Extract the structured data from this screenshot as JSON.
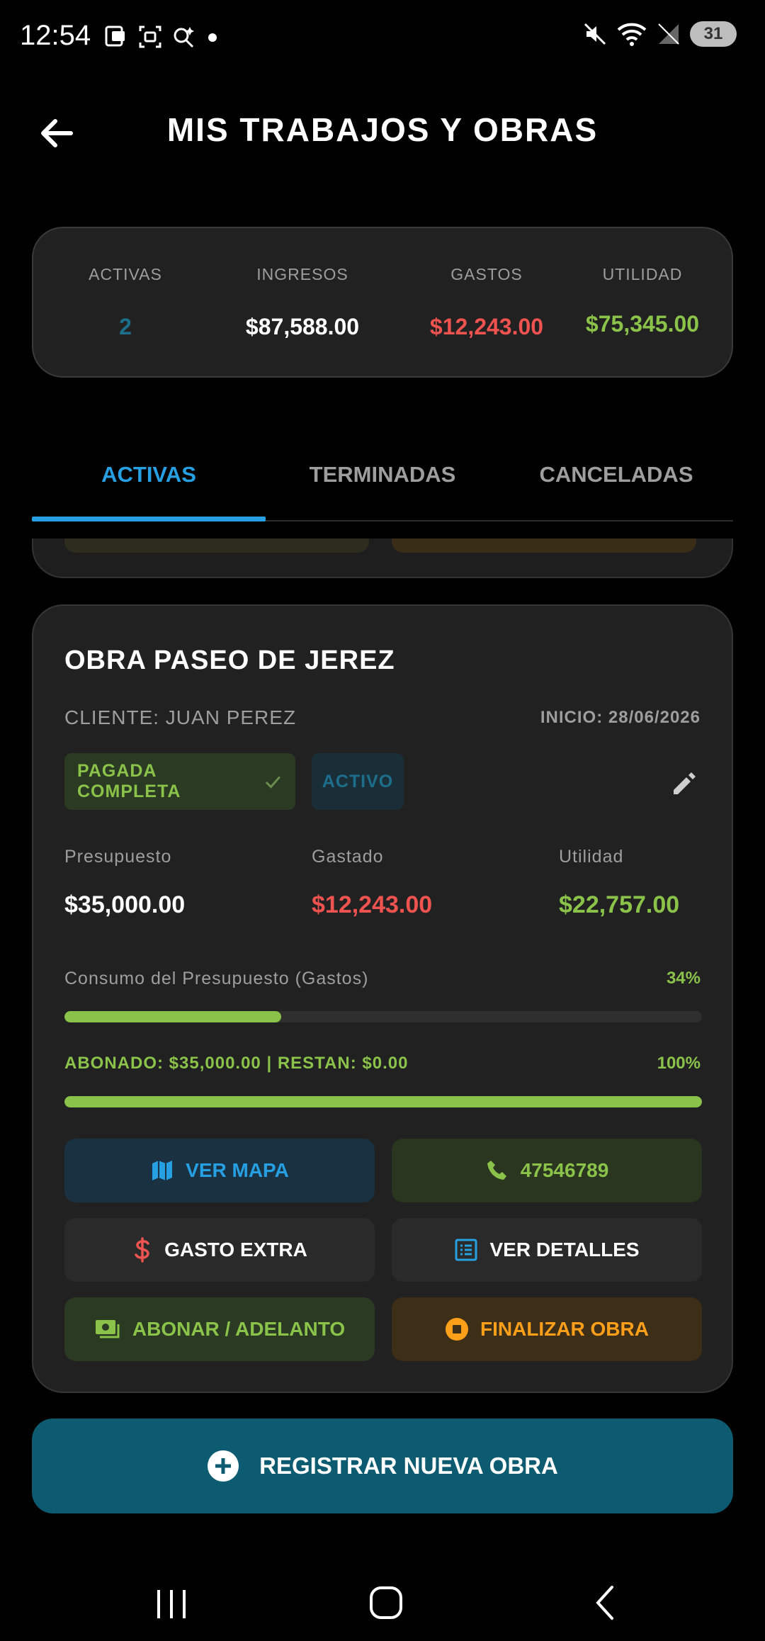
{
  "status_bar": {
    "time": "12:54",
    "battery": "31",
    "icons": [
      "sim-icon",
      "screenshot-icon",
      "assistant-icon",
      "notification-dot-icon",
      "mute-icon",
      "wifi-icon",
      "signal-icon",
      "battery-icon"
    ]
  },
  "header": {
    "title": "MIS TRABAJOS Y OBRAS",
    "back_icon": "arrow-left-icon"
  },
  "summary": {
    "activas": {
      "label": "ACTIVAS",
      "value": "2"
    },
    "ingresos": {
      "label": "INGRESOS",
      "value": "$87,588.00"
    },
    "gastos": {
      "label": "GASTOS",
      "value": "$12,243.00"
    },
    "utilidad": {
      "label": "UTILIDAD",
      "value": "$75,345.00"
    }
  },
  "tabs": [
    {
      "label": "ACTIVAS",
      "active": true
    },
    {
      "label": "TERMINADAS",
      "active": false
    },
    {
      "label": "CANCELADAS",
      "active": false
    }
  ],
  "card": {
    "title": "OBRA PASEO DE JEREZ",
    "client": "CLIENTE: JUAN PEREZ",
    "start": "INICIO: 28/06/2026",
    "badge_paid": "PAGADA COMPLETA",
    "badge_paid_icon": "check-icon",
    "badge_status": "ACTIVO",
    "edit_icon": "pencil-icon",
    "presupuesto": {
      "label": "Presupuesto",
      "value": "$35,000.00"
    },
    "gastado": {
      "label": "Gastado",
      "value": "$12,243.00"
    },
    "utilidad": {
      "label": "Utilidad",
      "value": "$22,757.00"
    },
    "consumo": {
      "label": "Consumo del Presupuesto (Gastos)",
      "percent_text": "34%",
      "fraction": 0.34
    },
    "abonado": {
      "label": "ABONADO: $35,000.00 | RESTAN: $0.00",
      "percent_text": "100%",
      "fraction": 1.0
    },
    "buttons": {
      "map": {
        "label": "VER MAPA",
        "icon": "map-icon"
      },
      "phone": {
        "label": "47546789",
        "icon": "phone-icon"
      },
      "extra": {
        "label": "GASTO EXTRA",
        "icon": "dollar-icon"
      },
      "details": {
        "label": "VER DETALLES",
        "icon": "list-icon"
      },
      "pay": {
        "label": "ABONAR / ADELANTO",
        "icon": "cash-icon"
      },
      "finish": {
        "label": "FINALIZAR OBRA",
        "icon": "stop-circle-icon"
      }
    }
  },
  "register_button": {
    "label": "REGISTRAR NUEVA OBRA",
    "icon": "plus-circle-icon"
  },
  "nav_bar": {
    "icons": [
      "recents-icon",
      "home-icon",
      "back-icon"
    ]
  },
  "colors": {
    "accent_blue": "#27a0e3",
    "green": "#8bc34a",
    "red": "#ef5350",
    "orange": "#ff9f1a",
    "teal": "#0d5b70",
    "card_bg": "#212121"
  }
}
